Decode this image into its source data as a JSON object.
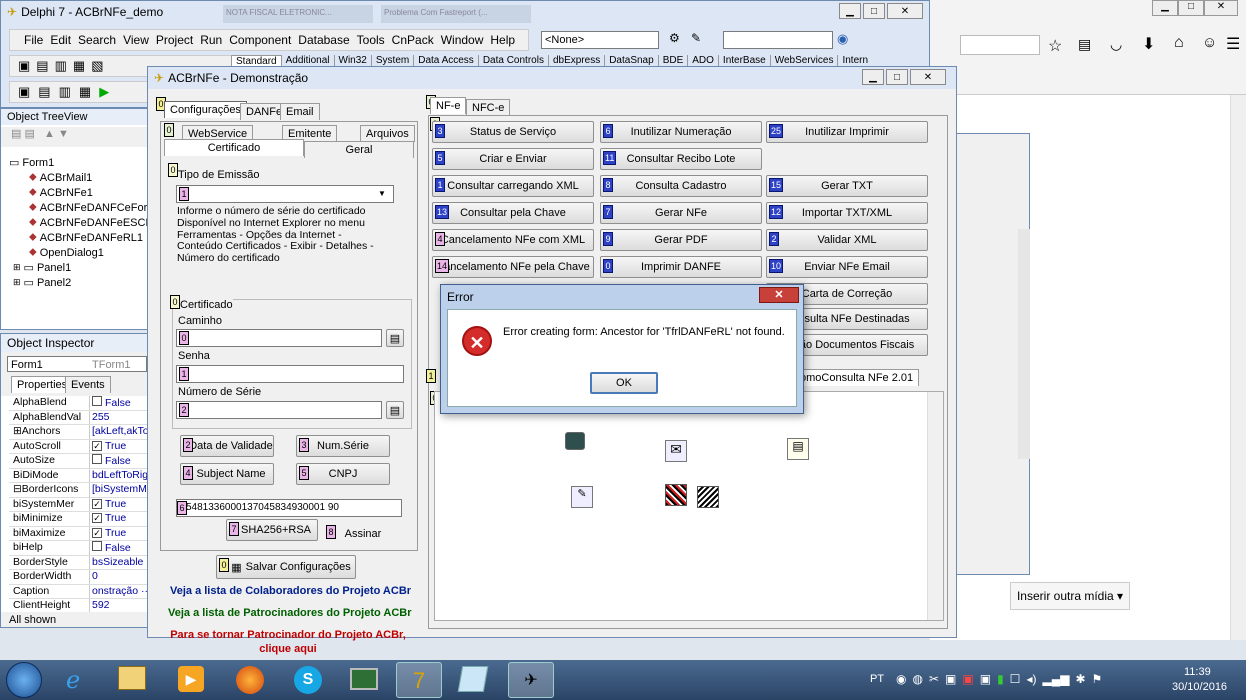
{
  "delphi": {
    "title": "Delphi 7 - ACBrNFe_demo",
    "menu": [
      "File",
      "Edit",
      "Search",
      "View",
      "Project",
      "Run",
      "Component",
      "Database",
      "Tools",
      "CnPack",
      "Window",
      "Help"
    ],
    "config_combo": "<None>",
    "palette_tabs": [
      "Standard",
      "Additional",
      "Win32",
      "System",
      "Data Access",
      "Data Controls",
      "dbExpress",
      "DataSnap",
      "BDE",
      "ADO",
      "InterBase",
      "WebServices",
      "Intern"
    ]
  },
  "browser_tabs": [
    "NOTA FISCAL ELETRONIC...",
    "Problema Com Fastreport (..."
  ],
  "tree": {
    "title": "Object TreeView",
    "items": [
      "Form1",
      "ACBrMail1",
      "ACBrNFe1",
      "ACBrNFeDANFCeForte",
      "ACBrNFeDANFeESCP(",
      "ACBrNFeDANFeRL1",
      "OpenDialog1",
      "Panel1",
      "Panel2"
    ]
  },
  "inspector": {
    "title": "Object Inspector",
    "object": "Form1",
    "object_type": "TForm1",
    "tabs": [
      "Properties",
      "Events"
    ],
    "rows": [
      {
        "k": "AlphaBlend",
        "v": "False",
        "check": "off"
      },
      {
        "k": "AlphaBlendVal",
        "v": "255"
      },
      {
        "k": "⊞Anchors",
        "v": "[akLeft,akTo"
      },
      {
        "k": "AutoScroll",
        "v": "True",
        "check": "on"
      },
      {
        "k": "AutoSize",
        "v": "False",
        "check": "off"
      },
      {
        "k": "BiDiMode",
        "v": "bdLeftToRigh"
      },
      {
        "k": "⊟BorderIcons",
        "v": "[biSystemMer"
      },
      {
        "k": "biSystemMer",
        "v": "True",
        "check": "on"
      },
      {
        "k": "biMinimize",
        "v": "True",
        "check": "on"
      },
      {
        "k": "biMaximize",
        "v": "True",
        "check": "on"
      },
      {
        "k": "biHelp",
        "v": "False",
        "check": "off"
      },
      {
        "k": "BorderStyle",
        "v": "bsSizeable"
      },
      {
        "k": "BorderWidth",
        "v": "0"
      },
      {
        "k": "Caption",
        "v": "onstração ···"
      },
      {
        "k": "ClientHeight",
        "v": "592"
      }
    ],
    "status": "All shown"
  },
  "acbr": {
    "title": "ACBrNFe - Demonstração",
    "left_tabs": [
      "Configurações",
      "DANFe",
      "Email"
    ],
    "sub_tabs_row1": [
      "WebService",
      "Emitente",
      "Arquivos"
    ],
    "sub_tabs_row2": [
      "Certificado",
      "Geral"
    ],
    "tipo_emissao_label": "Tipo de Emissão",
    "info_text": "Informe o número de série do certificado Disponível no Internet Explorer no menu Ferramentas - Opções da Internet - Conteúdo Certificados - Exibir - Detalhes - Número do certificado",
    "cert_group": "Certificado",
    "caminho_label": "Caminho",
    "senha_label": "Senha",
    "numero_serie_label": "Número de Série",
    "btn_data_validade": "Data de Validade",
    "btn_num_serie": "Num.Série",
    "btn_subject": "Subject Name",
    "btn_cnpj": "CNPJ",
    "cert_value": "5481336000137045834930001 90",
    "btn_sha": "SHA256+RSA",
    "btn_assinar": "Assinar",
    "btn_salvar": "Salvar Configurações",
    "link_colab": "Veja a lista de Colaboradores do Projeto ACBr",
    "link_patroc": "Veja a lista de Patrocinadores do Projeto ACBr",
    "link_tornar": "Para se tornar Patrocinador do Projeto ACBr, clique aqui",
    "right_tabs": [
      "NF-e",
      "NFC-e"
    ],
    "buttons": [
      [
        "Status de Serviço",
        "Inutilizar Numeração",
        "Inutilizar Imprimir"
      ],
      [
        "Criar e Enviar",
        "Consultar Recibo Lote",
        ""
      ],
      [
        "Consultar carregando XML",
        "Consulta Cadastro",
        "Gerar TXT"
      ],
      [
        "Consultar pela Chave",
        "Gerar NFe",
        "Importar TXT/XML"
      ],
      [
        "Cancelamento NFe com XML",
        "Gerar PDF",
        "Validar XML"
      ],
      [
        "Cancelamento NFe pela Chave",
        "Imprimir DANFE",
        "Enviar NFe Email"
      ],
      [
        "",
        "",
        "Carta de Correção"
      ],
      [
        "",
        "",
        "Consulta NFe Destinadas"
      ],
      [
        "",
        "",
        "ouição Documentos Fiscais"
      ]
    ],
    "bottom_tab": "omoConsulta NFe 2.01"
  },
  "dialog": {
    "title": "Error",
    "message": "Error creating form: Ancestor for 'TfrlDANFeRL' not found.",
    "ok": "OK"
  },
  "background": {
    "insert_media": "Inserir outra mídia ▾"
  },
  "taskbar": {
    "lang": "PT",
    "time": "11:39",
    "date": "30/10/2016"
  }
}
